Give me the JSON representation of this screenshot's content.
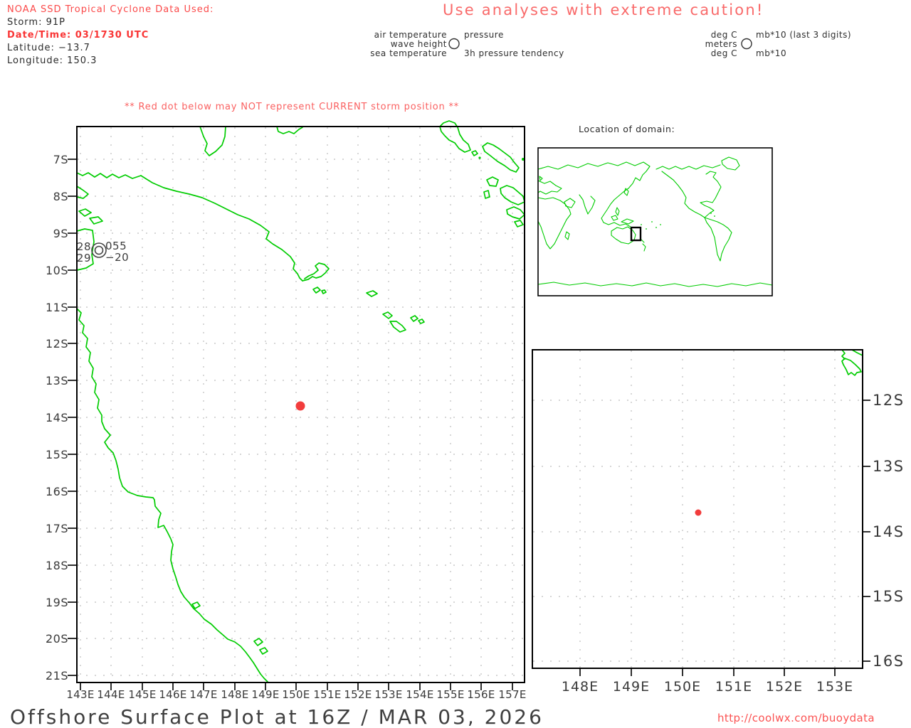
{
  "header": {
    "noaa": "NOAA SSD Tropical Cyclone Data Used:",
    "storm": "Storm: 91P",
    "datetime": "Date/Time: 03/1730 UTC",
    "latitude": "Latitude: −13.7",
    "longitude": "Longitude: 150.3"
  },
  "caution": {
    "text": "Use analyses with extreme caution!"
  },
  "station_legend": {
    "air_temp": "air temperature",
    "pressure": "pressure",
    "wave_height": "wave height",
    "sea_temp": "sea temperature",
    "tendency": "3h pressure tendency"
  },
  "units_legend": {
    "row1_left": "deg C",
    "row1_right": "mb*10 (last 3 digits)",
    "row2_left": "meters",
    "row3_left": "deg C",
    "row3_right": "mb*10"
  },
  "warning": {
    "text": "** Red dot below may NOT represent CURRENT storm position **"
  },
  "inset_map": {
    "title": "Location of domain:"
  },
  "main_map": {
    "y_labels": [
      "7S",
      "8S",
      "9S",
      "10S",
      "11S",
      "12S",
      "13S",
      "14S",
      "15S",
      "16S",
      "17S",
      "18S",
      "19S",
      "20S",
      "21S"
    ],
    "x_labels": [
      "143E",
      "144E",
      "145E",
      "146E",
      "147E",
      "148E",
      "149E",
      "150E",
      "151E",
      "152E",
      "153E",
      "154E",
      "155E",
      "156E",
      "157E"
    ],
    "station_plot": {
      "air_temp": "28",
      "pressure": "055",
      "sea_temp": "29",
      "tendency": "−20"
    },
    "storm_dot": {
      "lat": -13.7,
      "lon": 150.3
    }
  },
  "zoom_map": {
    "y_labels": [
      "12S",
      "13S",
      "14S",
      "15S",
      "16S"
    ],
    "x_labels": [
      "148E",
      "149E",
      "150E",
      "151E",
      "152E",
      "153E"
    ],
    "storm_dot": {
      "lat": -13.7,
      "lon": 150.3
    }
  },
  "footer": {
    "title": "Offshore Surface Plot at 16Z / MAR 03, 2026",
    "url": "http://coolwx.com/buoydata"
  },
  "colors": {
    "coastline_green": "#00cc00",
    "red_text": "#fb4949",
    "storm_dot_red": "#f23c3c",
    "grid_gray": "#bdbdbd",
    "frame_black": "#000000"
  }
}
